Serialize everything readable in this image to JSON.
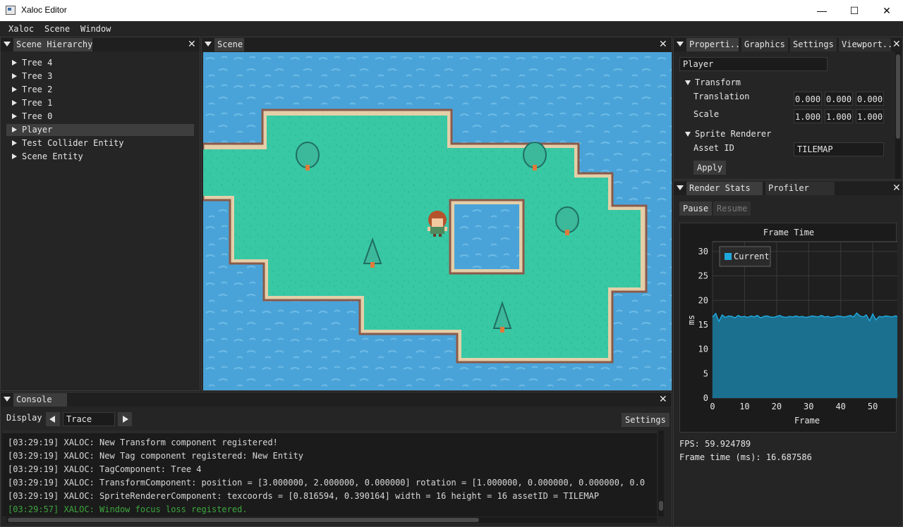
{
  "window": {
    "title": "Xaloc Editor"
  },
  "menu": [
    "Xaloc",
    "Scene",
    "Window"
  ],
  "hierarchy": {
    "tab": "Scene Hierarchy",
    "items": [
      "Tree 4",
      "Tree 3",
      "Tree 2",
      "Tree 1",
      "Tree 0",
      "Player",
      "Test Collider Entity",
      "Scene Entity"
    ],
    "selected": "Player"
  },
  "scene": {
    "tab": "Scene"
  },
  "properties": {
    "tabs": [
      "Properti...",
      "Graphics",
      "Settings",
      "Viewport..."
    ],
    "entity_name": "Player",
    "transform": {
      "header": "Transform",
      "translation_label": "Translation",
      "translation": [
        "0.000",
        "0.000",
        "0.000"
      ],
      "scale_label": "Scale",
      "scale": [
        "1.000",
        "1.000",
        "1.000"
      ]
    },
    "sprite": {
      "header": "Sprite Renderer",
      "asset_label": "Asset ID",
      "asset_value": "TILEMAP",
      "apply_label": "Apply"
    }
  },
  "stats": {
    "tabs": [
      "Render Stats",
      "Profiler"
    ],
    "pause_label": "Pause",
    "resume_label": "Resume",
    "fps": "FPS: 59.924789",
    "frame_time": "Frame time (ms): 16.687586"
  },
  "chart_data": {
    "type": "area",
    "title": "Frame Time",
    "xlabel": "Frame",
    "ylabel": "ms",
    "xlim": [
      0,
      59
    ],
    "ylim": [
      0,
      32
    ],
    "xticks": [
      0,
      10,
      20,
      30,
      40,
      50
    ],
    "yticks": [
      0,
      5,
      10,
      15,
      20,
      25,
      30
    ],
    "legend_position": "top-left",
    "series": [
      {
        "name": "Current",
        "color": "#1fa8dd",
        "x": [
          0,
          1,
          2,
          3,
          4,
          5,
          6,
          7,
          8,
          9,
          10,
          11,
          12,
          13,
          14,
          15,
          16,
          17,
          18,
          19,
          20,
          21,
          22,
          23,
          24,
          25,
          26,
          27,
          28,
          29,
          30,
          31,
          32,
          33,
          34,
          35,
          36,
          37,
          38,
          39,
          40,
          41,
          42,
          43,
          44,
          45,
          46,
          47,
          48,
          49,
          50,
          51,
          52,
          53,
          54,
          55,
          56,
          57,
          58,
          59
        ],
        "values": [
          16.6,
          17.3,
          15.7,
          17.0,
          16.5,
          16.8,
          16.7,
          16.4,
          16.9,
          16.6,
          16.7,
          16.5,
          16.8,
          16.6,
          16.9,
          16.4,
          16.7,
          16.8,
          16.6,
          16.5,
          16.7,
          16.9,
          16.6,
          16.5,
          16.7,
          16.6,
          16.8,
          16.6,
          16.7,
          16.5,
          16.6,
          16.8,
          16.7,
          16.6,
          16.9,
          16.6,
          16.7,
          16.5,
          16.6,
          16.8,
          16.7,
          16.6,
          16.7,
          16.9,
          16.6,
          17.4,
          16.8,
          16.6,
          17.0,
          15.8,
          17.2,
          16.0,
          16.7,
          16.6,
          16.8,
          16.7,
          16.6,
          16.8,
          16.7,
          17.5
        ]
      }
    ]
  },
  "console": {
    "tab": "Console",
    "display_label": "Display",
    "level": "Trace",
    "settings_label": "Settings",
    "lines": [
      "[03:29:19] XALOC: New Transform component registered!",
      "[03:29:19] XALOC: New Tag component registered: New Entity",
      "[03:29:19] XALOC:         TagComponent: Tree 4",
      "[03:29:19] XALOC:         TransformComponent: position = [3.000000, 2.000000, 0.000000]    rotation = [1.000000, 0.000000, 0.000000, 0.0",
      "[03:29:19] XALOC:         SpriteRendererComponent: texcoords = [0.816594, 0.390164]    width = 16    height = 16    assetID = TILEMAP"
    ],
    "last_line": "[03:29:57] XALOC: Window focus loss registered."
  }
}
